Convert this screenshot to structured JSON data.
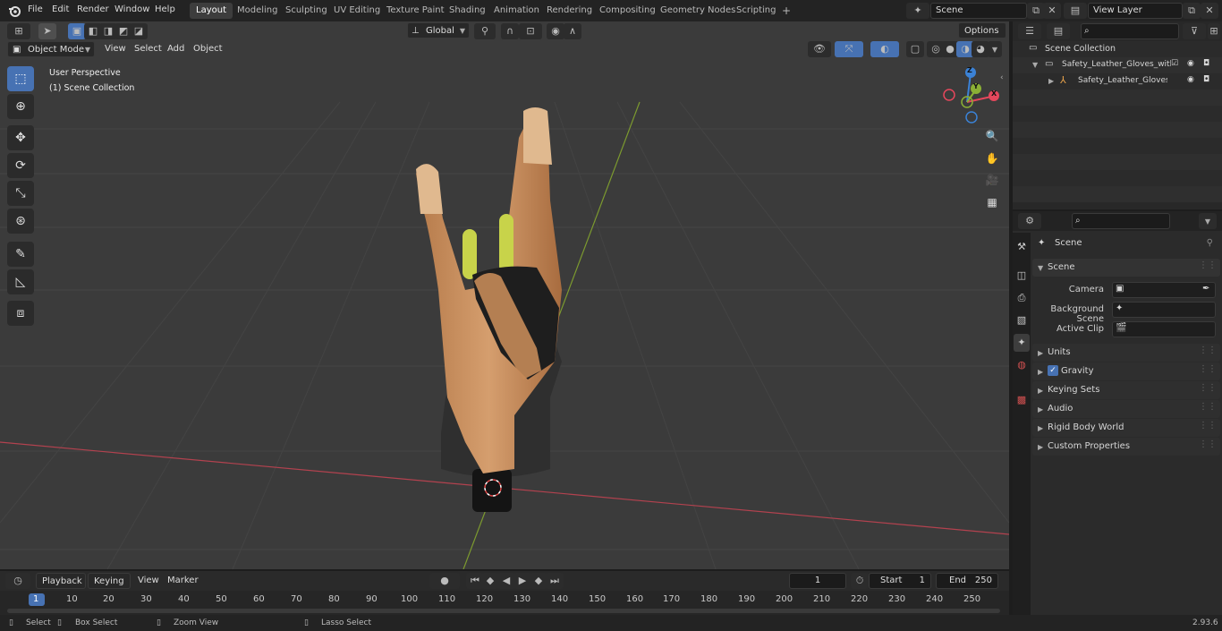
{
  "topbar": {
    "menu": [
      "File",
      "Edit",
      "Render",
      "Window",
      "Help"
    ],
    "workspaces": [
      "Layout",
      "Modeling",
      "Sculpting",
      "UV Editing",
      "Texture Paint",
      "Shading",
      "Animation",
      "Rendering",
      "Compositing",
      "Geometry Nodes",
      "Scripting"
    ],
    "active_workspace": "Layout",
    "add_tab": "+",
    "scene_name": "Scene",
    "view_layer": "View Layer"
  },
  "viewport": {
    "mode": "Object Mode",
    "menu": [
      "View",
      "Select",
      "Add",
      "Object"
    ],
    "transform_orientation": "Global",
    "options_label": "Options",
    "overlay_text1": "User Perspective",
    "overlay_text2": "(1) Scene Collection",
    "gizmo": {
      "x": "X",
      "y": "Y",
      "z": "Z"
    }
  },
  "outliner": {
    "root": "Scene Collection",
    "items": [
      {
        "label": "Safety_Leather_Gloves_with_"
      },
      {
        "label": "Safety_Leather_Gloves_v"
      }
    ]
  },
  "properties": {
    "header": "Scene",
    "panel_title": "Scene",
    "fields": [
      {
        "label": "Camera",
        "value": ""
      },
      {
        "label": "Background Scene",
        "value": ""
      },
      {
        "label": "Active Clip",
        "value": ""
      }
    ],
    "sections": [
      "Units",
      "Gravity",
      "Keying Sets",
      "Audio",
      "Rigid Body World",
      "Custom Properties"
    ],
    "gravity_checked": true
  },
  "timeline": {
    "menu": [
      "Playback",
      "Keying",
      "View",
      "Marker"
    ],
    "current_frame": "1",
    "start_label": "Start",
    "start": "1",
    "end_label": "End",
    "end": "250",
    "ruler": [
      "1",
      "10",
      "20",
      "30",
      "40",
      "50",
      "60",
      "70",
      "80",
      "90",
      "100",
      "110",
      "120",
      "130",
      "140",
      "150",
      "160",
      "170",
      "180",
      "190",
      "200",
      "210",
      "220",
      "230",
      "240",
      "250"
    ]
  },
  "statusbar": {
    "select": "Select",
    "box_select": "Box Select",
    "zoom_view": "Zoom View",
    "lasso_select": "Lasso Select",
    "version": "2.93.6"
  },
  "colors": {
    "accent": "#4772b3",
    "x_axis": "#e5475c",
    "y_axis": "#8bb035",
    "z_axis": "#3b82d6",
    "viewport_bg": "#3b3b3b"
  },
  "icons": [
    "blender-icon",
    "editor-type-icon",
    "cursor-icon",
    "move-icon",
    "rotate-icon",
    "scale-icon",
    "transform-icon",
    "annotate-icon",
    "measure-icon",
    "add-cube-icon",
    "zoom-icon",
    "hand-icon",
    "camera-icon",
    "grid-icon",
    "eye-icon",
    "camera-small-icon",
    "pin-icon",
    "play-icon"
  ]
}
